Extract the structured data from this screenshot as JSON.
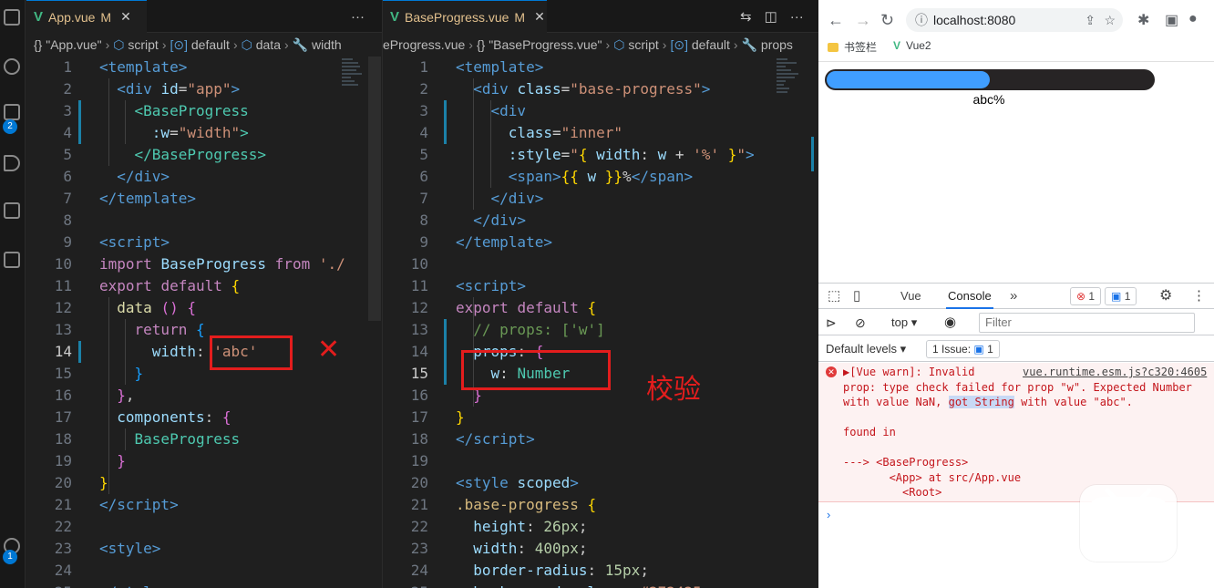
{
  "editor_left": {
    "tab": {
      "icon": "V",
      "name": "App.vue",
      "status": "M",
      "close": "✕"
    },
    "tools": {
      "more": "···"
    },
    "breadcrumb": [
      "{} \"App.vue\"",
      "script",
      "default",
      "data",
      "width"
    ],
    "line_numbers": [
      "1",
      "2",
      "3",
      "4",
      "5",
      "6",
      "7",
      "8",
      "9",
      "10",
      "11",
      "12",
      "13",
      "14",
      "15",
      "16",
      "17",
      "18",
      "19",
      "20",
      "21",
      "22",
      "23",
      "24",
      "25"
    ],
    "current_line": "14"
  },
  "editor_right": {
    "tab": {
      "icon": "V",
      "name": "BaseProgress.vue",
      "status": "M",
      "close": "✕"
    },
    "breadcrumb": [
      "eProgress.vue",
      "{} \"BaseProgress.vue\"",
      "script",
      "default",
      "props"
    ],
    "line_numbers": [
      "1",
      "2",
      "3",
      "4",
      "5",
      "6",
      "7",
      "8",
      "9",
      "10",
      "11",
      "12",
      "13",
      "14",
      "15",
      "16",
      "17",
      "18",
      "19",
      "20",
      "21",
      "22",
      "23",
      "24",
      "25"
    ],
    "current_line": "15"
  },
  "annotations": {
    "cross": "✕",
    "validate": "校验"
  },
  "browser": {
    "url": "localhost:8080",
    "bookmarks": [
      "书签栏",
      "Vue2"
    ],
    "progress": {
      "fraction": 0.5,
      "label": "abc%"
    },
    "devtools": {
      "tabs": [
        "Vue",
        "Console"
      ],
      "active_tab": "Console",
      "error_count": "1",
      "message_count": "1",
      "context": "top",
      "filter_placeholder": "Filter",
      "levels": "Default levels",
      "issues": "1 Issue:",
      "issues_count": "1",
      "warning": {
        "head": "▶[Vue warn]: Invalid",
        "source": "vue.runtime.esm.js?c320:4605",
        "line2": "prop: type check failed for prop \"w\". Expected Number",
        "line3a": "with value NaN, ",
        "line3sel": "got String",
        "line3b": " with value \"abc\".",
        "line4": "found in",
        "line5": "---> <BaseProgress>",
        "line6": "       <App> at src/App.vue",
        "line7": "         <Root>"
      },
      "prompt": "›"
    }
  }
}
